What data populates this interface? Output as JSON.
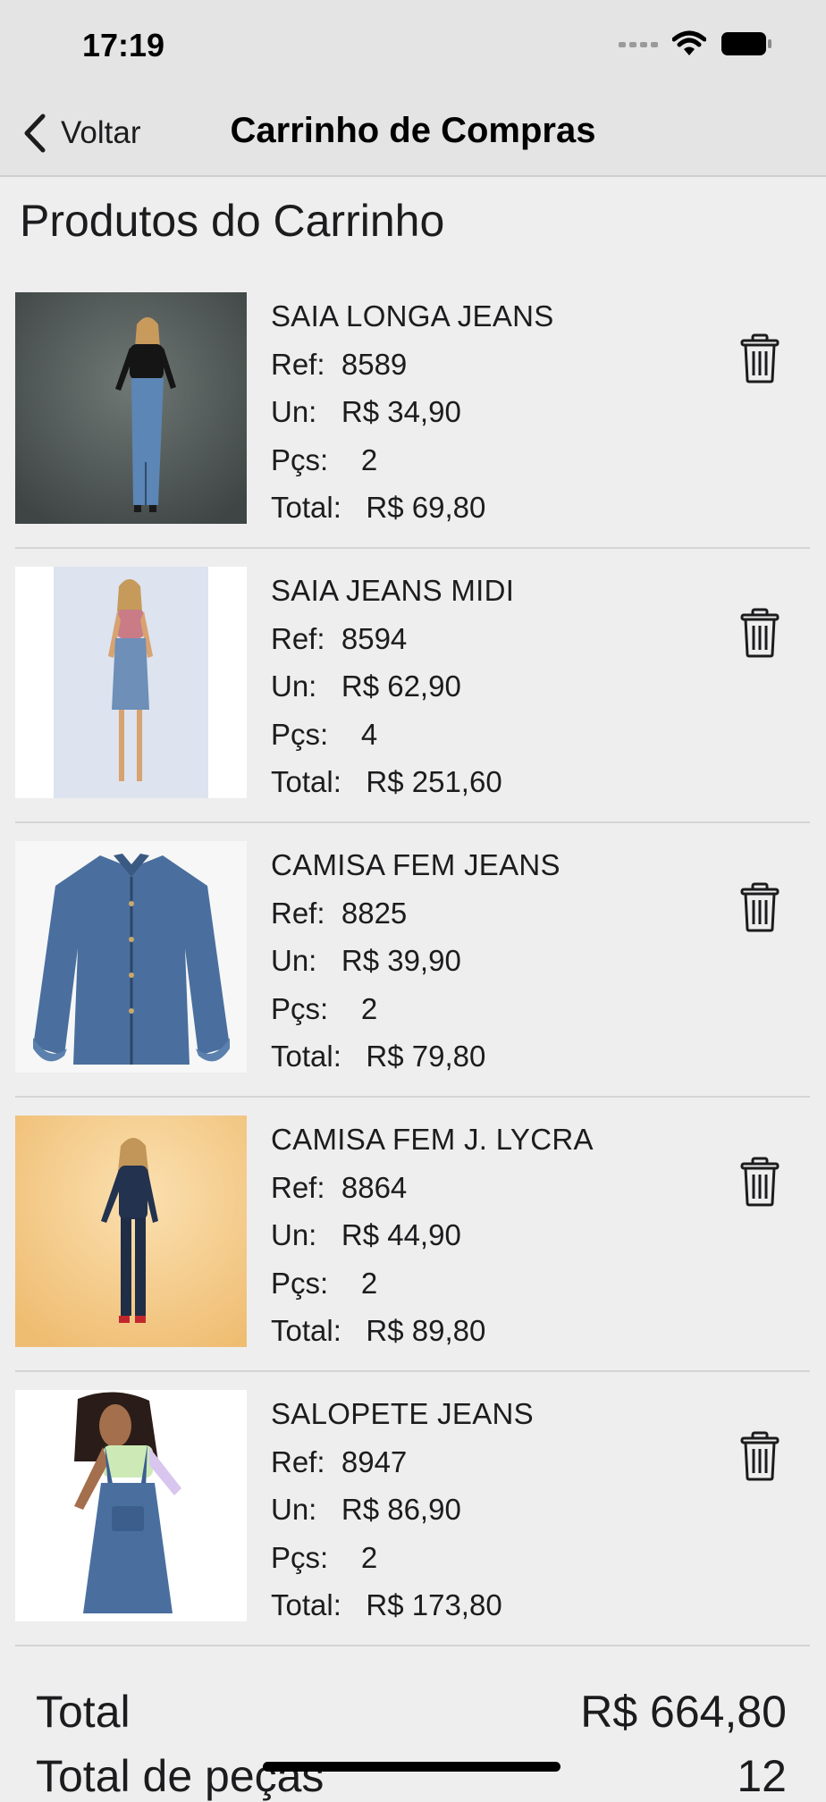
{
  "status_bar": {
    "time": "17:19"
  },
  "nav": {
    "back_label": "Voltar",
    "title": "Carrinho de Compras"
  },
  "section_title": "Produtos do Carrinho",
  "labels": {
    "ref": "Ref:",
    "unit": "Un:",
    "qty": "Pçs:",
    "total": "Total:"
  },
  "items": [
    {
      "name": "SAIA LONGA JEANS",
      "ref": "8589",
      "unit_price": "R$ 34,90",
      "qty": "2",
      "total": "R$ 69,80",
      "image": "model-long-denim-skirt"
    },
    {
      "name": "SAIA JEANS MIDI",
      "ref": "8594",
      "unit_price": "R$ 62,90",
      "qty": "4",
      "total": "R$ 251,60",
      "image": "model-midi-denim-skirt"
    },
    {
      "name": "CAMISA FEM JEANS",
      "ref": "8825",
      "unit_price": "R$ 39,90",
      "qty": "2",
      "total": "R$ 79,80",
      "image": "denim-shirt-flat"
    },
    {
      "name": "CAMISA FEM J. LYCRA",
      "ref": "8864",
      "unit_price": "R$ 44,90",
      "qty": "2",
      "total": "R$ 89,80",
      "image": "model-denim-outfit"
    },
    {
      "name": "SALOPETE JEANS",
      "ref": "8947",
      "unit_price": "R$ 86,90",
      "qty": "2",
      "total": "R$ 173,80",
      "image": "model-denim-overall"
    }
  ],
  "summary": {
    "total_label": "Total",
    "total_value": "R$ 664,80",
    "pieces_label": "Total de peças",
    "pieces_value": "12"
  }
}
